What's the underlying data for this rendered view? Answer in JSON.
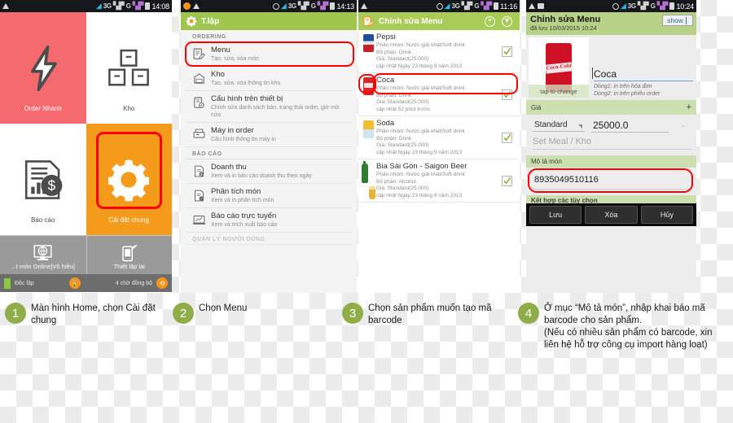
{
  "panels": {
    "p1": {
      "status": {
        "time": "14:08",
        "network": "3G",
        "network2": "G",
        "icons": [
          "warning-triangle",
          "wifi",
          "signal",
          "battery"
        ]
      },
      "tiles": [
        {
          "label": "Order Nhanh",
          "icon": "lightning-bolt-icon",
          "color": "#f46a6e"
        },
        {
          "label": "Kho",
          "icon": "boxes-icon",
          "color": "#fefefe"
        },
        {
          "label": "Báo cáo",
          "icon": "report-dollar-icon",
          "color": "#fefefe"
        },
        {
          "label": "Cài đặt chung",
          "icon": "gear-icon",
          "color": "#f49b1b",
          "highlighted": true
        }
      ],
      "bottom_tiles": [
        {
          "label": "...t món Online[Vô hiệu]",
          "icon": "monitor-globe-icon"
        },
        {
          "label": "Thiết lập lại",
          "icon": "phone-wifi-icon"
        }
      ],
      "status_left": "Độc lập",
      "status_right": "4 chờ đồng bộ"
    },
    "p2": {
      "status": {
        "time": "14:13",
        "network": "3G",
        "network2": "G"
      },
      "appbar_title": "T.lập",
      "appbar_icon": "gear-icon",
      "sections": [
        {
          "header": "ORDERING",
          "items": [
            {
              "title": "Menu",
              "sub": "Tạo, sửa, xóa món",
              "icon": "menu-edit-icon",
              "highlighted": true
            },
            {
              "title": "Kho",
              "sub": "Tạo, sửa, xóa thông tin kho",
              "icon": "warehouse-icon",
              "highlighted": false
            },
            {
              "title": "Cấu hình trên thiết bị",
              "sub": "Chỉnh sửa danh sách bàn, trạng thái order, giờ mở cửa",
              "icon": "device-config-icon",
              "highlighted": false
            },
            {
              "title": "Máy in order",
              "sub": "Cấu hình thông tin máy in",
              "icon": "printer-icon",
              "highlighted": false
            }
          ]
        },
        {
          "header": "BÁO CÁO",
          "items": [
            {
              "title": "Doanh thu",
              "sub": "Xem và in báo cáo doanh thu theo ngày",
              "icon": "revenue-icon",
              "highlighted": false
            },
            {
              "title": "Phân tích món",
              "sub": "Xem và in phân tích món",
              "icon": "analysis-icon",
              "highlighted": false
            },
            {
              "title": "Báo cáo trực tuyến",
              "sub": "Xem và trích xuất báo cáo",
              "icon": "online-report-icon",
              "highlighted": false
            }
          ]
        },
        {
          "header": "QUẢN LÝ NGƯỜI DÙNG",
          "items": []
        }
      ]
    },
    "p3": {
      "status": {
        "time": "11:16",
        "network": "3G",
        "network2": "G"
      },
      "appbar_title": "Chỉnh sửa Menu",
      "appbar_icon": "menu-edit-icon",
      "add_button": "+",
      "more_button": "▾",
      "items": [
        {
          "name": "Pepsi",
          "thumb": "pepsi-can",
          "group": "Phân nhóm: Nước giải khát/Soft drink",
          "dept": "Bộ phận: Drink",
          "price": "Giá: Standard(25.000)",
          "updated": "cập nhật Ngày 23 tháng 9 năm 2013",
          "checked": true,
          "highlighted": false
        },
        {
          "name": "Coca",
          "thumb": "coke-can",
          "group": "Phân nhóm: Nước giải khát/Soft drink",
          "dept": "Bộ phận: Drink",
          "price": "Giá: Standard(25.000)",
          "updated": "cập nhật 52 phút trước",
          "checked": true,
          "highlighted": true
        },
        {
          "name": "Soda",
          "thumb": "soda-can",
          "group": "Phân nhóm: Nước giải khát/Soft drink",
          "dept": "Bộ phận: Drink",
          "price": "Giá: Standard(25.000)",
          "updated": "cập nhật Ngày 23 tháng 9 năm 2013",
          "checked": true,
          "highlighted": false
        },
        {
          "name": "Bia Sài Gòn - Saigon Beer",
          "thumb": "beer-bottle",
          "group": "Phân nhóm: Nước giải khát/Soft drink",
          "dept": "Bộ phận: Alcohol",
          "price": "Giá: Standard(25.000)",
          "updated": "cập nhật Ngày 23 tháng 9 năm 2013",
          "checked": true,
          "highlighted": false
        }
      ]
    },
    "p4": {
      "status": {
        "time": "10:24",
        "network": "3G",
        "network2": "G"
      },
      "title": "Chỉnh sửa Menu",
      "subtitle": "đã lưu 10/03/2015 10:24",
      "show_label": "show",
      "image_caption": "tap to change",
      "image_alt": "coca-cola-can",
      "name_value": "Coca",
      "hint1": "Dòng1: in trên hóa đơn",
      "hint2": "Dòng2: in trên phiếu order",
      "price_section": "Giá",
      "price_add": "+",
      "price_type": "Standard",
      "price_value": "25000.0",
      "price_remove": "-",
      "setmeal_placeholder": "Set Meal / Kho",
      "desc_section": "Mô tả món",
      "desc_value": "8935049510116",
      "options_section": "Kết hợp các tùy chọn",
      "buttons": [
        "Lưu",
        "Xóa",
        "Hủy"
      ]
    }
  },
  "captions": [
    {
      "number": "1",
      "text": "Màn hình Home, chọn Cài đặt chung"
    },
    {
      "number": "2",
      "text": "Chọn Menu"
    },
    {
      "number": "3",
      "text": "Chọn sản phẩm muốn tạo mã barcode"
    },
    {
      "number": "4",
      "text": "Ở mục “Mô tả món”, nhập khai báo mã barcode cho sản phẩm.\n(Nếu có nhiều sản phẩm có barcode,  xin liên hệ hỗ trợ công cụ import hàng loạt)"
    }
  ],
  "colors": {
    "highlight_red": "#ff0000",
    "badge_green": "#8fae49",
    "appbar_green": "#9fc54d",
    "tile_red": "#f46a6e",
    "tile_orange": "#f49b1b"
  }
}
